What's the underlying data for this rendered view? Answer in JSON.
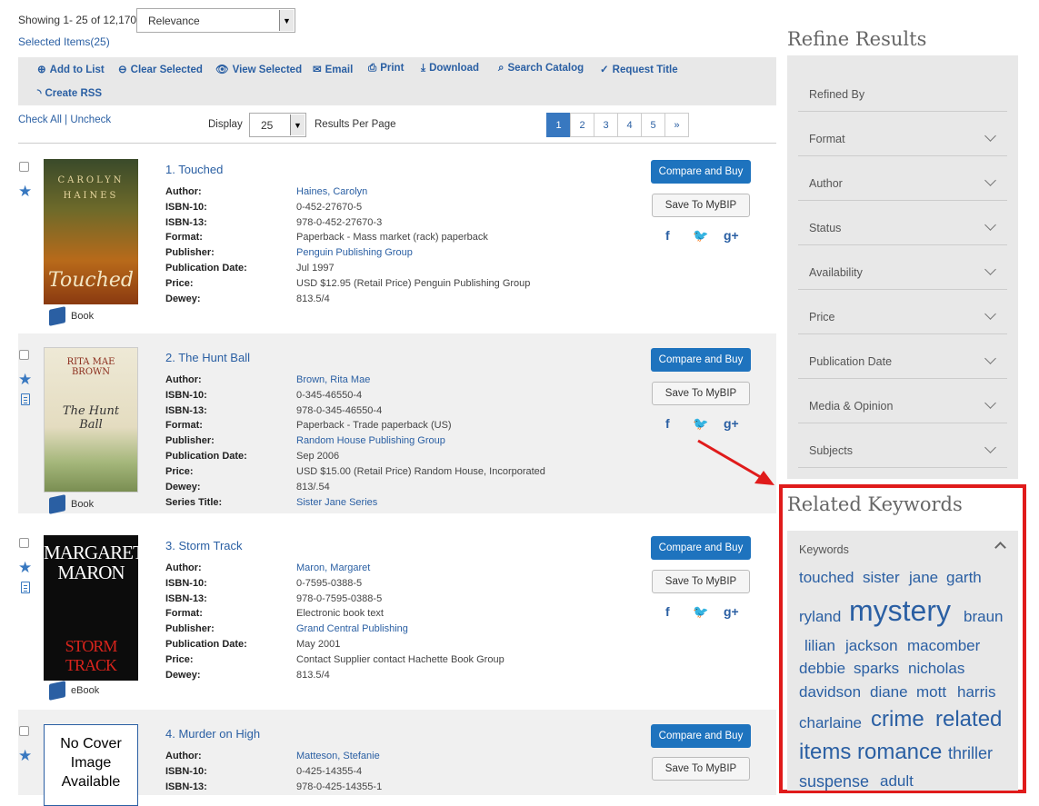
{
  "header": {
    "showing": "Showing 1- 25 of 12,170",
    "sort_value": "Relevance",
    "selected_items": "Selected Items(25)"
  },
  "toolbar": {
    "add_to_list": "Add to List",
    "clear_selected": "Clear Selected",
    "view_selected": "View Selected",
    "email": "Email",
    "print": "Print",
    "download": "Download",
    "search_catalog": "Search Catalog",
    "request_title": "Request Title",
    "create_rss": "Create RSS"
  },
  "list_controls": {
    "check_all": "Check All",
    "separator": "|",
    "uncheck": "Uncheck",
    "display_label": "Display",
    "per_page": "25",
    "per_page_suffix": "Results Per Page",
    "pages": [
      "1",
      "2",
      "3",
      "4",
      "5",
      "»"
    ]
  },
  "labels": {
    "author": "Author:",
    "isbn10": "ISBN-10:",
    "isbn13": "ISBN-13:",
    "format": "Format:",
    "publisher": "Publisher:",
    "pub_date": "Publication Date:",
    "price": "Price:",
    "dewey": "Dewey:",
    "series": "Series Title:",
    "compare_buy": "Compare and Buy",
    "save_mybip": "Save To MyBIP"
  },
  "results": [
    {
      "title": "1. Touched",
      "author": "Haines, Carolyn",
      "isbn10": "0-452-27670-5",
      "isbn13": "978-0-452-27670-3",
      "format": "Paperback - Mass market (rack) paperback",
      "publisher": "Penguin Publishing Group",
      "pub_date": "Jul 1997",
      "price": "USD $12.95 (Retail Price) Penguin Publishing Group",
      "dewey": "813.5/4",
      "media": "Book",
      "cover_top": "CAROLYN",
      "cover_top2": "HAINES",
      "cover_title": "Touched"
    },
    {
      "title": "2. The Hunt Ball",
      "author": "Brown, Rita Mae",
      "isbn10": "0-345-46550-4",
      "isbn13": "978-0-345-46550-4",
      "format": "Paperback - Trade paperback (US)",
      "publisher": "Random House Publishing Group",
      "pub_date": "Sep 2006",
      "price": "USD $15.00 (Retail Price) Random House, Incorporated",
      "dewey": "813/.54",
      "series": "Sister Jane Series",
      "media": "Book",
      "cover_top": "RITA MAE",
      "cover_top2": "BROWN",
      "cover_title": "The Hunt Ball"
    },
    {
      "title": "3. Storm Track",
      "author": "Maron, Margaret",
      "isbn10": "0-7595-0388-5",
      "isbn13": "978-0-7595-0388-5",
      "format": "Electronic book text",
      "publisher": "Grand Central Publishing",
      "pub_date": "May 2001",
      "price": "Contact Supplier contact Hachette Book Group",
      "dewey": "813.5/4",
      "media": "eBook",
      "cover_top": "MARGARET",
      "cover_top2": "MARON",
      "cover_title": "STORM TRACK"
    },
    {
      "title": "4. Murder on High",
      "author": "Matteson, Stefanie",
      "isbn10": "0-425-14355-4",
      "isbn13": "978-0-425-14355-1",
      "cover_placeholder": "No Cover Image Available"
    }
  ],
  "sidebar": {
    "refine_title": "Refine Results",
    "facets": [
      "Refined By",
      "Format",
      "Author",
      "Status",
      "Availability",
      "Price",
      "Publication Date",
      "Media & Opinion",
      "Subjects"
    ],
    "keywords_title": "Related Keywords",
    "keywords_label": "Keywords",
    "keywords": [
      "touched",
      "sister",
      "jane",
      "garth",
      "ryland",
      "mystery",
      "braun",
      "lilian",
      "jackson",
      "macomber",
      "debbie",
      "sparks",
      "nicholas",
      "davidson",
      "diane",
      "mott",
      "harris",
      "charlaine",
      "crime",
      "related",
      "items",
      "romance",
      "thriller",
      "suspense",
      "adult"
    ]
  },
  "colors": {
    "accent": "#1e73be",
    "link": "#2a5fa3",
    "highlight": "#e01b1b",
    "panel": "#e8e8e8"
  }
}
